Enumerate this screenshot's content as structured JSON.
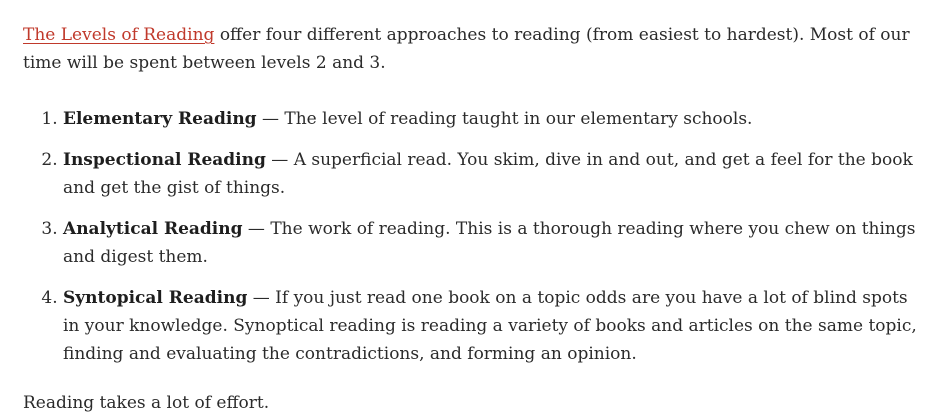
{
  "intro": {
    "link_text": "The Levels of Reading",
    "text": " offer four different approaches to reading (from easiest to hardest). Most of our time will be spent between levels 2 and 3."
  },
  "levels": [
    {
      "term": "Elementary Reading",
      "description": " — The level of reading taught in our elementary schools."
    },
    {
      "term": "Inspectional Reading",
      "description": " — A superficial read. You skim, dive in and out, and get a feel for the book and get the gist of things."
    },
    {
      "term": "Analytical Reading",
      "description": " — The work of reading. This is a thorough reading where you chew on things and digest them."
    },
    {
      "term": "Syntopical Reading",
      "description": "  —  If you just read one book on a topic odds are you have a lot of blind spots in your knowledge. Synoptical reading is reading a variety of books and articles on the same topic, finding and evaluating the contradictions, and forming an opinion."
    }
  ],
  "outro": {
    "text": "Reading takes a lot of effort."
  },
  "colors": {
    "link": "#c0392b",
    "text": "#2b2b2b"
  }
}
